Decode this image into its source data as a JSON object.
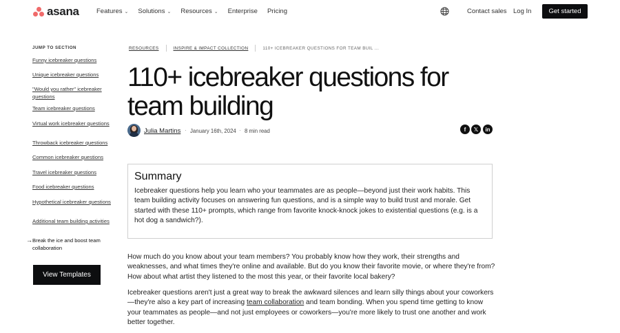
{
  "nav": {
    "logo_text": "asana",
    "links": [
      {
        "label": "Features",
        "dropdown": true
      },
      {
        "label": "Solutions",
        "dropdown": true
      },
      {
        "label": "Resources",
        "dropdown": true
      },
      {
        "label": "Enterprise",
        "dropdown": false
      },
      {
        "label": "Pricing",
        "dropdown": false
      }
    ],
    "contact_sales": "Contact sales",
    "log_in": "Log In",
    "get_started": "Get started",
    "brand_color": "#f06a6a"
  },
  "sidebar": {
    "jump_label": "JUMP TO SECTION",
    "items": [
      "Funny icebreaker questions",
      "Unique icebreaker questions",
      "\"Would you rather\" icebreaker questions",
      "Team icebreaker questions",
      "Virtual work icebreaker questions",
      "Throwback icebreaker questions",
      "Common icebreaker questions",
      "Travel icebreaker questions",
      "Food icebreaker questions",
      "Hypothetical icebreaker questions",
      "Additional team building activities"
    ],
    "active_item": "Break the ice and boost team collaboration",
    "view_templates": "View Templates"
  },
  "breadcrumb": {
    "items": [
      "RESOURCES",
      "INSPIRE & IMPACT COLLECTION"
    ],
    "current": "110+ ICEBREAKER QUESTIONS FOR TEAM BUIL ..."
  },
  "article": {
    "title": "110+ icebreaker questions for team building",
    "author": "Julia Martins",
    "date": "January 16th, 2024",
    "read_time": "8 min read",
    "share": {
      "facebook": "f",
      "x": "𝕏",
      "linkedin": "in"
    }
  },
  "summary": {
    "heading": "Summary",
    "text": "Icebreaker questions help you learn who your teammates are as people—beyond just their work habits. This team building activity focuses on answering fun questions, and is a simple way to build trust and morale. Get started with these 110+ prompts, which range from favorite knock-knock jokes to existential questions (e.g. is a hot dog a sandwich?)."
  },
  "body": {
    "p1": "How much do you know about your team members? You probably know how they work, their strengths and weaknesses, and what times they're online and available. But do you know their favorite movie, or where they're from? How about what artist they listened to the most this year, or their favorite local bakery?",
    "p2_before": "Icebreaker questions aren't just a great way to break the awkward silences and learn silly things about your coworkers—they're also a key part of increasing ",
    "p2_link": "team collaboration",
    "p2_after": " and team bonding. When you spend time getting to know your teammates as people—and not just employees or coworkers—you're more likely to trust one another and work better together."
  }
}
